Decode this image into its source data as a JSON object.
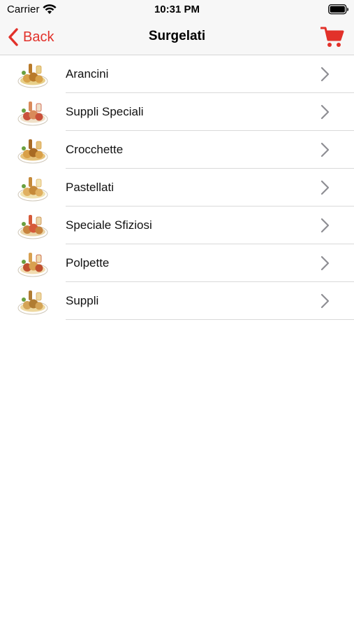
{
  "status_bar": {
    "carrier": "Carrier",
    "time": "10:31 PM"
  },
  "nav": {
    "back_label": "Back",
    "title": "Surgelati"
  },
  "colors": {
    "accent": "#e2312a",
    "chevron": "#8e8e93",
    "separator": "#d9d9d9"
  },
  "items": [
    {
      "label": "Arancini",
      "icon": "food-thumbnail"
    },
    {
      "label": "Suppli Speciali",
      "icon": "food-thumbnail"
    },
    {
      "label": "Crocchette",
      "icon": "food-thumbnail"
    },
    {
      "label": "Pastellati",
      "icon": "food-thumbnail"
    },
    {
      "label": "Speciale Sfiziosi",
      "icon": "food-thumbnail"
    },
    {
      "label": "Polpette",
      "icon": "food-thumbnail"
    },
    {
      "label": "Suppli",
      "icon": "food-thumbnail"
    }
  ]
}
